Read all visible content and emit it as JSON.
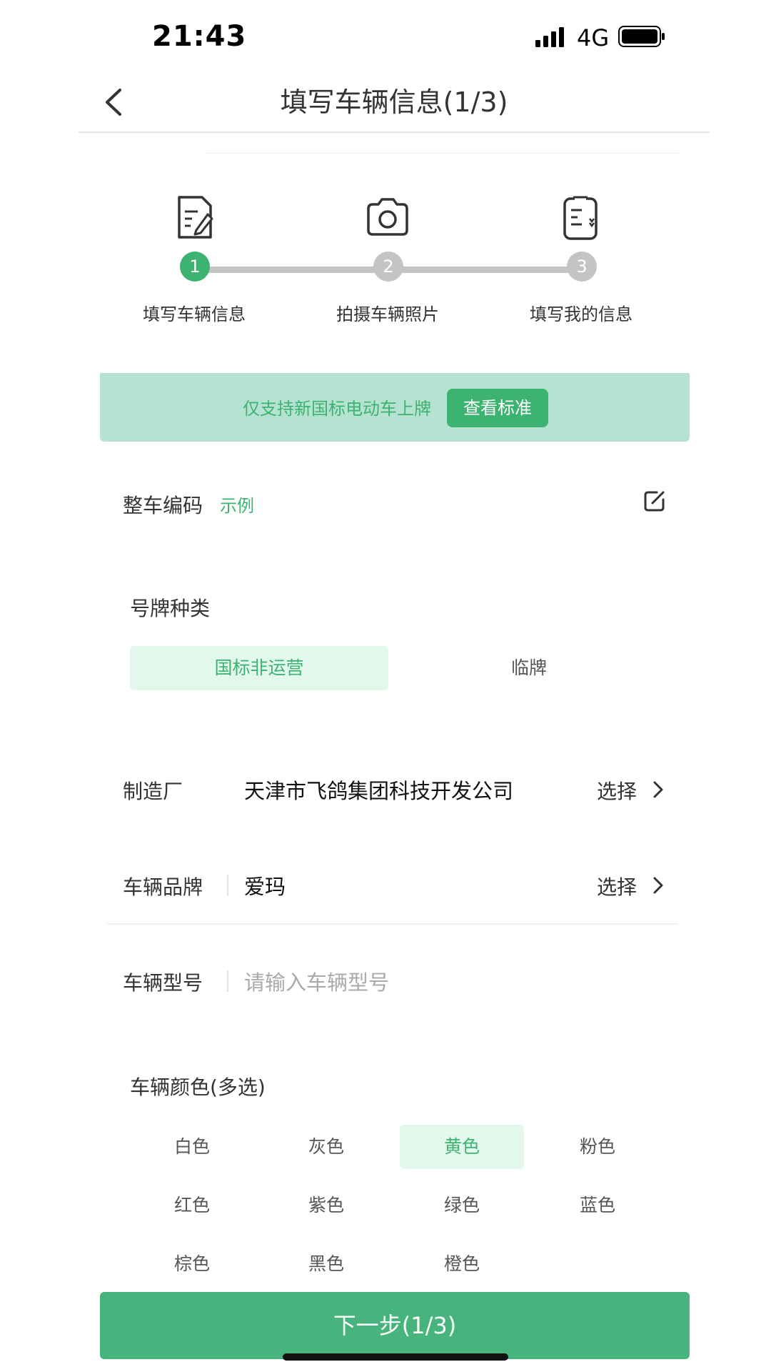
{
  "status_bar": {
    "time": "21:43",
    "network": "4G"
  },
  "nav": {
    "title": "填写车辆信息(1/3)"
  },
  "steps": [
    {
      "number": "1",
      "label": "填写车辆信息",
      "icon": "document-edit-icon",
      "active": true
    },
    {
      "number": "2",
      "label": "拍摄车辆照片",
      "icon": "camera-icon",
      "active": false
    },
    {
      "number": "3",
      "label": "填写我的信息",
      "icon": "clipboard-icon",
      "active": false
    }
  ],
  "notice": {
    "text": "仅支持新国标电动车上牌",
    "button": "查看标准"
  },
  "vin": {
    "label": "整车编码",
    "example": "示例"
  },
  "plate_type": {
    "label": "号牌种类",
    "options": [
      {
        "label": "国标非运营",
        "selected": true
      },
      {
        "label": "临牌",
        "selected": false
      }
    ]
  },
  "manufacturer": {
    "label": "制造厂",
    "value": "天津市飞鸽集团科技开发公司",
    "select": "选择"
  },
  "brand": {
    "label": "车辆品牌",
    "value": "爱玛",
    "select": "选择"
  },
  "model": {
    "label": "车辆型号",
    "placeholder": "请输入车辆型号"
  },
  "colors": {
    "label": "车辆颜色(多选)",
    "options": [
      {
        "label": "白色",
        "selected": false
      },
      {
        "label": "灰色",
        "selected": false
      },
      {
        "label": "黄色",
        "selected": true
      },
      {
        "label": "粉色",
        "selected": false
      },
      {
        "label": "红色",
        "selected": false
      },
      {
        "label": "紫色",
        "selected": false
      },
      {
        "label": "绿色",
        "selected": false
      },
      {
        "label": "蓝色",
        "selected": false
      },
      {
        "label": "棕色",
        "selected": false
      },
      {
        "label": "黑色",
        "selected": false
      },
      {
        "label": "橙色",
        "selected": false
      }
    ]
  },
  "footer": {
    "next": "下一步(1/3)"
  },
  "theme": {
    "accent": "#3cb371",
    "accent_light": "#e2f8ec",
    "notice_bg": "#b6e3d1"
  }
}
